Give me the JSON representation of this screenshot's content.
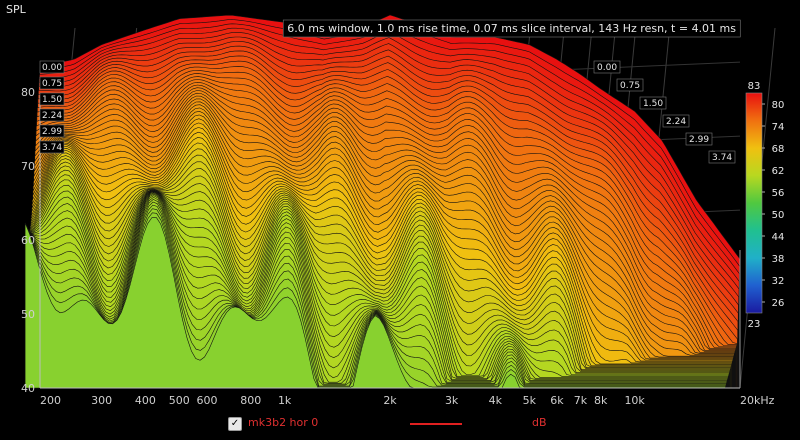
{
  "chart_data": {
    "type": "waterfall",
    "title": "6.0 ms window, 1.0 ms rise time, 0.07 ms slice interval, 143 Hz resn, t = 4.01 ms",
    "ylabel": "SPL",
    "xlabel": "",
    "x_scale": "log",
    "xlim": [
      200,
      20000
    ],
    "ylim": [
      40,
      83
    ],
    "x_ticks": [
      {
        "f": 200,
        "label": "200"
      },
      {
        "f": 300,
        "label": "300"
      },
      {
        "f": 400,
        "label": "400"
      },
      {
        "f": 500,
        "label": "500"
      },
      {
        "f": 600,
        "label": "600"
      },
      {
        "f": 800,
        "label": "800"
      },
      {
        "f": 1000,
        "label": "1k"
      },
      {
        "f": 2000,
        "label": "2k"
      },
      {
        "f": 3000,
        "label": "3k"
      },
      {
        "f": 4000,
        "label": "4k"
      },
      {
        "f": 5000,
        "label": "5k"
      },
      {
        "f": 6000,
        "label": "6k"
      },
      {
        "f": 7000,
        "label": "7k"
      },
      {
        "f": 8000,
        "label": "8k"
      },
      {
        "f": 10000,
        "label": "10k"
      },
      {
        "f": 20000,
        "label": "20kHz"
      }
    ],
    "y_ticks": [
      40,
      50,
      60,
      70,
      80
    ],
    "time_labels": [
      "0.00",
      "0.75",
      "1.50",
      "2.24",
      "2.99",
      "3.74"
    ],
    "colorbar": {
      "min": 23,
      "max": 83,
      "ticks": [
        80,
        74,
        68,
        62,
        56,
        50,
        44,
        38,
        32,
        26
      ],
      "colors": [
        "#1a1aa0",
        "#2060d0",
        "#20b0c8",
        "#20c090",
        "#50c840",
        "#b8d820",
        "#f0c010",
        "#f07010",
        "#e81010"
      ]
    },
    "slices": {
      "count": 58,
      "start_ms": 0.0,
      "interval_ms": 0.07,
      "base_curve": [
        {
          "f": 200,
          "db": 76
        },
        {
          "f": 250,
          "db": 77
        },
        {
          "f": 300,
          "db": 79
        },
        {
          "f": 400,
          "db": 81
        },
        {
          "f": 500,
          "db": 82.5
        },
        {
          "f": 700,
          "db": 83
        },
        {
          "f": 1000,
          "db": 82
        },
        {
          "f": 1300,
          "db": 80.5
        },
        {
          "f": 1700,
          "db": 81.5
        },
        {
          "f": 2000,
          "db": 83
        },
        {
          "f": 2500,
          "db": 81.5
        },
        {
          "f": 3000,
          "db": 80
        },
        {
          "f": 4000,
          "db": 80
        },
        {
          "f": 5000,
          "db": 79
        },
        {
          "f": 6000,
          "db": 77
        },
        {
          "f": 7000,
          "db": 75
        },
        {
          "f": 8000,
          "db": 73
        },
        {
          "f": 10000,
          "db": 70
        },
        {
          "f": 12000,
          "db": 66
        },
        {
          "f": 15000,
          "db": 58
        },
        {
          "f": 20000,
          "db": 50
        }
      ]
    }
  },
  "legend": {
    "checked_mark": "✓",
    "series_name": "mk3b2 hor 0",
    "unit": "dB",
    "line_color": "#e02020"
  }
}
